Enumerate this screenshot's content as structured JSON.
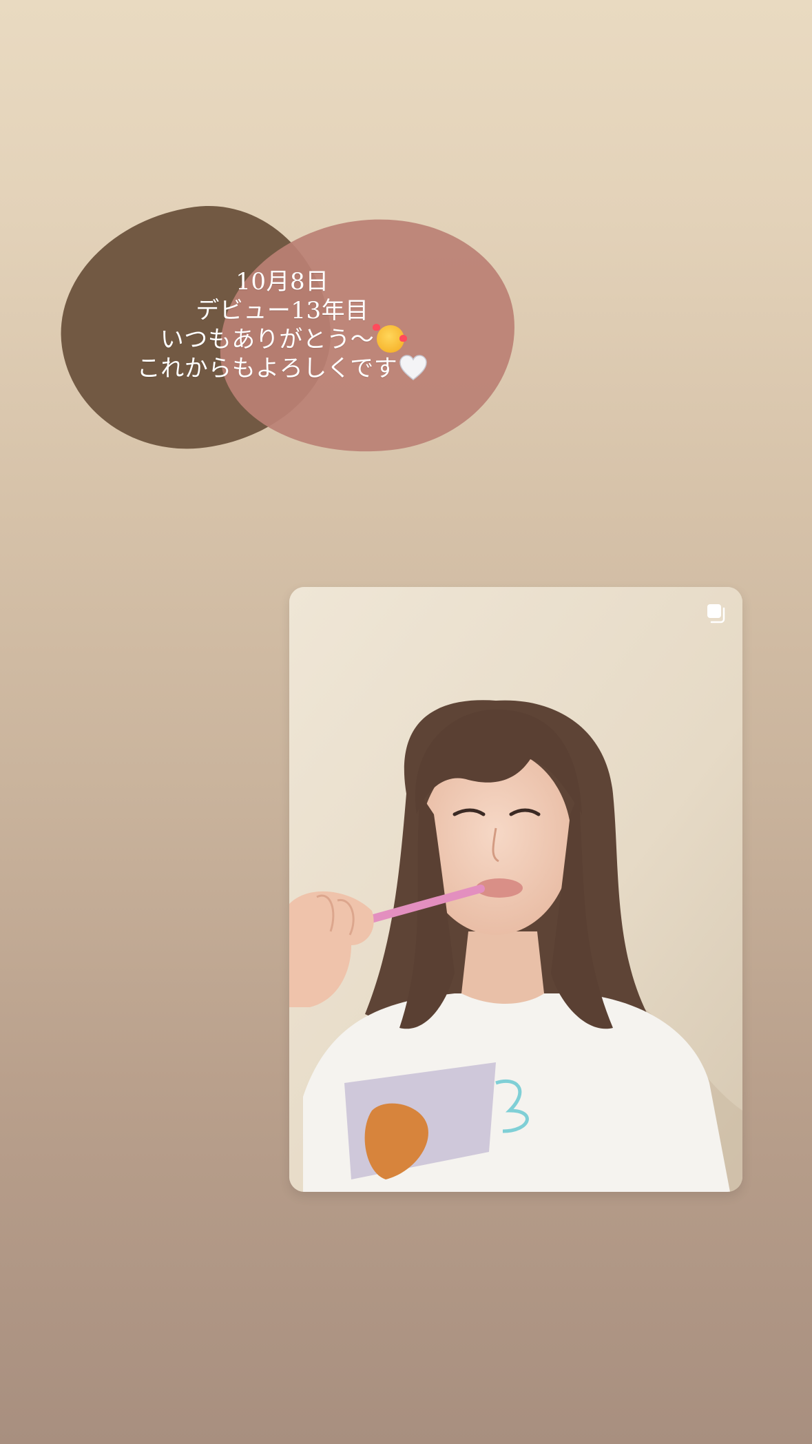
{
  "story": {
    "caption_lines": [
      "10月8日",
      "デビュー13年目",
      "いつもありがとう〜",
      "これからもよろしくです"
    ],
    "emojis": [
      "smiling-face-with-hearts-emoji",
      "white-heart-emoji"
    ]
  },
  "shared_post": {
    "icon": "multiple-photos-icon",
    "username": "",
    "colors": {
      "dark_blob": "#6f5740",
      "rose_blob": "#bb8074"
    }
  }
}
